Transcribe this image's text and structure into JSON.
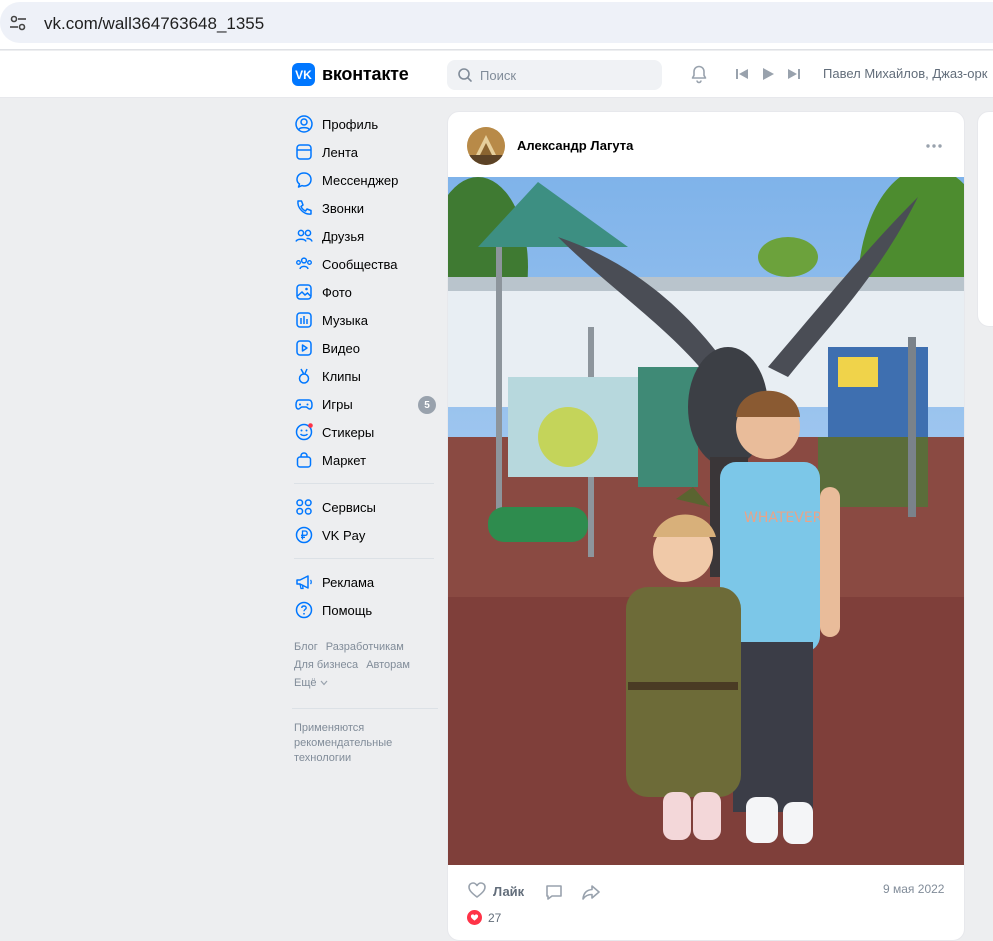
{
  "browser": {
    "url": "vk.com/wall364763648_1355"
  },
  "header": {
    "logo_badge": "VK",
    "logo_text": "вконтакте",
    "search_placeholder": "Поиск",
    "now_playing": "Павел Михайлов, Джаз-орк"
  },
  "nav": {
    "items": [
      {
        "label": "Профиль",
        "icon": "profile-icon"
      },
      {
        "label": "Лента",
        "icon": "feed-icon"
      },
      {
        "label": "Мессенджер",
        "icon": "messenger-icon"
      },
      {
        "label": "Звонки",
        "icon": "phone-icon"
      },
      {
        "label": "Друзья",
        "icon": "friends-icon"
      },
      {
        "label": "Сообщества",
        "icon": "communities-icon"
      },
      {
        "label": "Фото",
        "icon": "photo-icon"
      },
      {
        "label": "Музыка",
        "icon": "music-icon"
      },
      {
        "label": "Видео",
        "icon": "video-icon"
      },
      {
        "label": "Клипы",
        "icon": "clips-icon"
      },
      {
        "label": "Игры",
        "icon": "gamepad-icon",
        "badge": "5"
      },
      {
        "label": "Стикеры",
        "icon": "sticker-icon"
      },
      {
        "label": "Маркет",
        "icon": "shopping-bag-icon"
      }
    ],
    "items2": [
      {
        "label": "Сервисы",
        "icon": "services-icon"
      },
      {
        "label": "VK Pay",
        "icon": "ruble-icon"
      }
    ],
    "items3": [
      {
        "label": "Реклама",
        "icon": "megaphone-icon"
      },
      {
        "label": "Помощь",
        "icon": "help-icon"
      }
    ],
    "footer_links": [
      "Блог",
      "Разработчикам",
      "Для бизнеса",
      "Авторам",
      "Ещё"
    ],
    "recsys_text": "Применяются рекомендательные технологии"
  },
  "post": {
    "author": "Александр Лагута",
    "like_label": "Лайк",
    "date": "9 мая 2022",
    "reaction_count": "27"
  },
  "colors": {
    "accent": "#0077ff",
    "background": "#edeef0",
    "secondary_text": "#818c99",
    "reaction": "#ff3347"
  }
}
